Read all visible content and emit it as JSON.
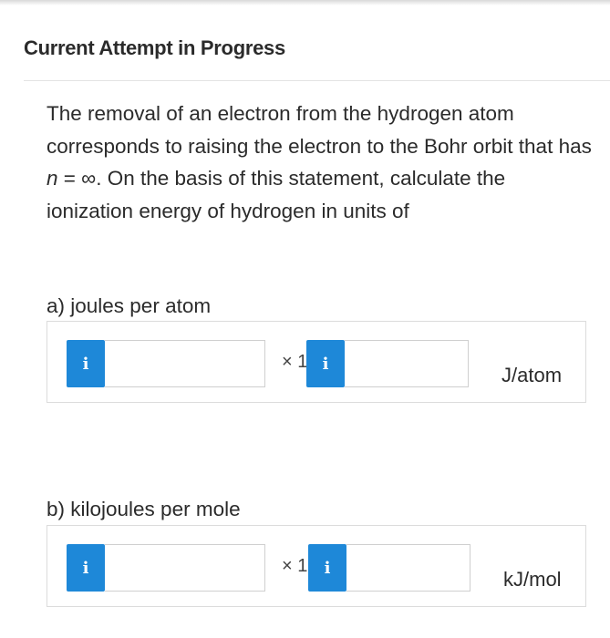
{
  "header": {
    "title": "Current Attempt in Progress"
  },
  "question": {
    "text_before": "The removal of an electron from the hydrogen atom corresponds to raising the electron to the Bohr orbit that has ",
    "variable": "n",
    "equals_infinity": " = ∞",
    "text_after": ". On the basis of this statement, calculate the ionization energy of hydrogen in units of"
  },
  "parts": [
    {
      "label": "a) joules per atom",
      "info_icon": "i",
      "mantissa_value": "",
      "times_label": "× 1",
      "exponent_value": "",
      "unit": "J/atom"
    },
    {
      "label": "b) kilojoules per mole",
      "info_icon": "i",
      "mantissa_value": "",
      "times_label": "× 1",
      "exponent_value": "",
      "unit": "kJ/mol"
    }
  ],
  "colors": {
    "info_button": "#1e88d8",
    "border": "#dcdcdc",
    "text": "#2b2b2b"
  }
}
